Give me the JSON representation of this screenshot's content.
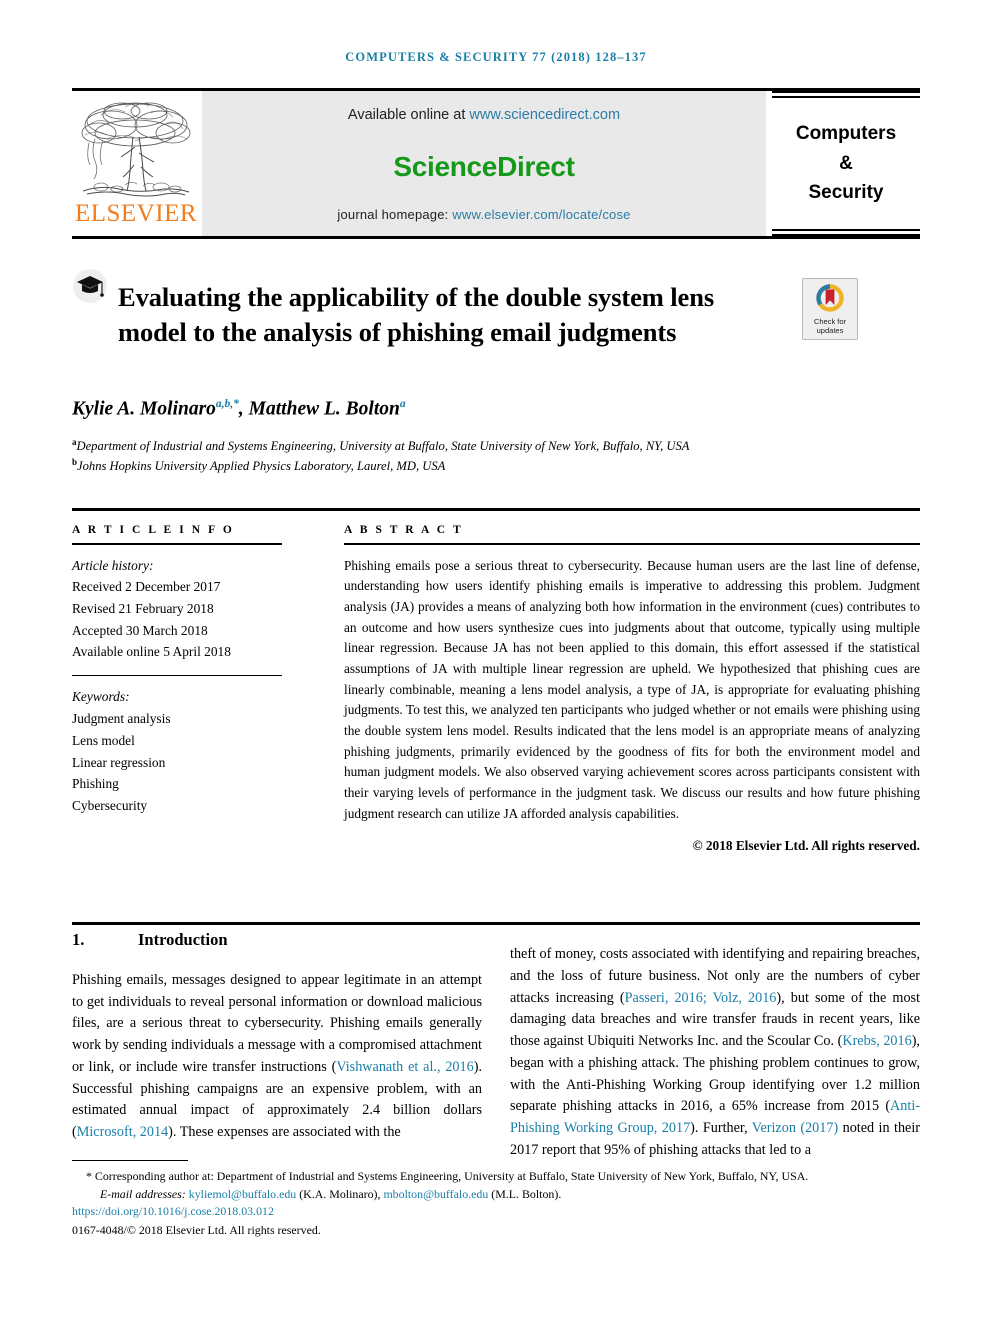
{
  "running_head": "COMPUTERS & SECURITY 77 (2018) 128–137",
  "banner": {
    "publisher_wordmark": "ELSEVIER",
    "available_prefix": "Available online at ",
    "available_url": "www.sciencedirect.com",
    "sciencedirect_logo": "ScienceDirect",
    "homepage_prefix": "journal homepage: ",
    "homepage_url": "www.elsevier.com/locate/cose",
    "journal_line1": "Computers",
    "journal_line2": "&",
    "journal_line3": "Security",
    "sd_green": "#16991b",
    "elsevier_orange": "#f07c1e",
    "link_blue": "#2b7ca6"
  },
  "title": {
    "text": "Evaluating the applicability of the double system lens model to the analysis of phishing email judgments",
    "icon": "graduation-cap-icon"
  },
  "crossmark": {
    "line1": "Check for",
    "line2": "updates"
  },
  "authors": {
    "author1_name": "Kylie A. Molinaro",
    "author1_sup": "a,b,*",
    "separator": ", ",
    "author2_name": "Matthew L. Bolton",
    "author2_sup": "a",
    "affiliation_a_marker": "a",
    "affiliation_a": "Department of Industrial and Systems Engineering, University at Buffalo, State University of New York, Buffalo, NY, USA",
    "affiliation_b_marker": "b",
    "affiliation_b": "Johns Hopkins University Applied Physics Laboratory, Laurel, MD, USA"
  },
  "article_info": {
    "heading": "A R T I C L E   I N F O",
    "history_label": "Article history:",
    "history": [
      "Received 2 December 2017",
      "Revised 21 February 2018",
      "Accepted 30 March 2018",
      "Available online 5 April 2018"
    ],
    "keywords_label": "Keywords:",
    "keywords": [
      "Judgment analysis",
      "Lens model",
      "Linear regression",
      "Phishing",
      "Cybersecurity"
    ]
  },
  "abstract": {
    "heading": "A B S T R A C T",
    "text": "Phishing emails pose a serious threat to cybersecurity. Because human users are the last line of defense, understanding how users identify phishing emails is imperative to addressing this problem. Judgment analysis (JA) provides a means of analyzing both how information in the environment (cues) contributes to an outcome and how users synthesize cues into judgments about that outcome, typically using multiple linear regression. Because JA has not been applied to this domain, this effort assessed if the statistical assumptions of JA with multiple linear regression are upheld. We hypothesized that phishing cues are linearly combinable, meaning a lens model analysis, a type of JA, is appropriate for evaluating phishing judgments. To test this, we analyzed ten participants who judged whether or not emails were phishing using the double system lens model. Results indicated that the lens model is an appropriate means of analyzing phishing judgments, primarily evidenced by the goodness of fits for both the environment model and human judgment models. We also observed varying achievement scores across participants consistent with their varying levels of performance in the judgment task. We discuss our results and how future phishing judgment research can utilize JA afforded analysis capabilities.",
    "copyright": "© 2018 Elsevier Ltd. All rights reserved."
  },
  "section": {
    "number": "1.",
    "name": "Introduction"
  },
  "body": {
    "left_part1": "Phishing emails, messages designed to appear legitimate in an attempt to get individuals to reveal personal information or download malicious files, are a serious threat to cybersecurity. Phishing emails generally work by sending individuals a message with a compromised attachment or link, or include wire transfer instructions (",
    "left_cite1": "Vishwanath et al., 2016",
    "left_part2": "). Successful phishing campaigns are an expensive problem, with an estimated annual impact of approximately 2.4 billion dollars (",
    "left_cite2": "Microsoft, 2014",
    "left_part3": "). These expenses are associated with the",
    "right_part1": "theft of money, costs associated with identifying and repairing breaches, and the loss of future business. Not only are the numbers of cyber attacks increasing (",
    "right_cite1": "Passeri, 2016; Volz, 2016",
    "right_part2": "), but some of the most damaging data breaches and wire transfer frauds in recent years, like those against Ubiquiti Networks Inc. and the Scoular Co. (",
    "right_cite2": "Krebs, 2016",
    "right_part3": "), began with a phishing attack. The phishing problem continues to grow, with the Anti-Phishing Working Group identifying over 1.2 million separate phishing attacks in 2016, a 65% increase from 2015 (",
    "right_cite3": "Anti-Phishing Working Group, 2017",
    "right_part4": "). Further, ",
    "right_cite4": "Verizon (2017)",
    "right_part5": " noted in their 2017 report that 95% of phishing attacks that led to a"
  },
  "footnote": {
    "corresponding_marker": "*",
    "corresponding_text": " Corresponding author at: Department of Industrial and Systems Engineering, University at Buffalo, State University of New York, Buffalo, NY, USA.",
    "email_label": "E-mail addresses:",
    "email1": "kyliemol@buffalo.edu",
    "email1_owner": " (K.A. Molinaro), ",
    "email2": "mbolton@buffalo.edu",
    "email2_owner": " (M.L. Bolton).",
    "doi": "https://doi.org/10.1016/j.cose.2018.03.012",
    "issn": "0167-4048/© 2018 Elsevier Ltd. All rights reserved."
  }
}
